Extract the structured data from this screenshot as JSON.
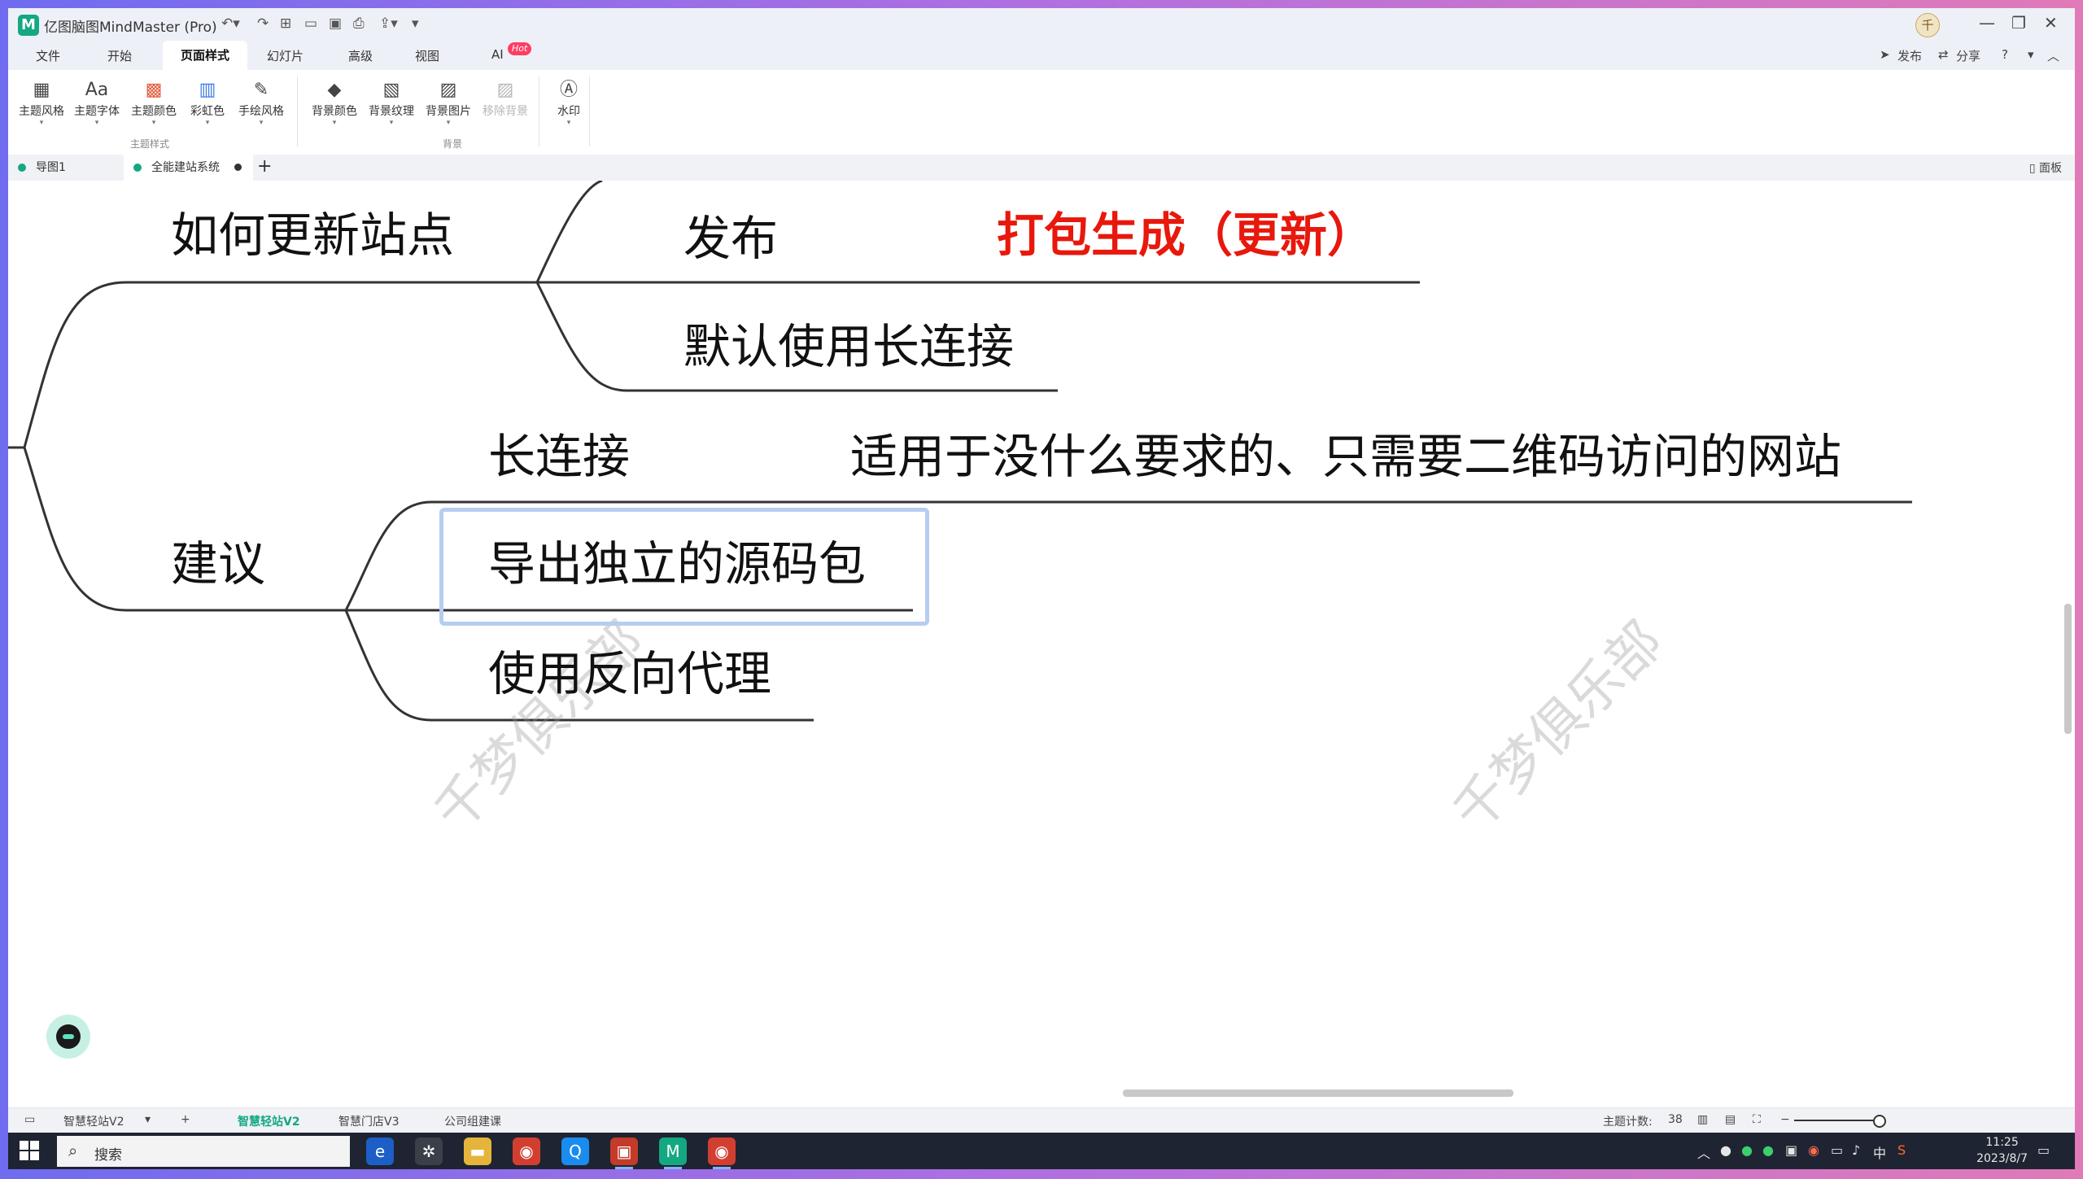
{
  "app": {
    "title": "亿图脑图MindMaster (Pro)",
    "user_initial": "千"
  },
  "menu": {
    "tabs": [
      "文件",
      "开始",
      "页面样式",
      "幻灯片",
      "高级",
      "视图",
      "AI"
    ],
    "active_tab": "页面样式",
    "ai_badge": "Hot",
    "publish": "发布",
    "share": "分享",
    "help": "?"
  },
  "ribbon": {
    "theme_style": "主题风格",
    "theme_font": "主题字体",
    "theme_color": "主题颜色",
    "rainbow": "彩虹色",
    "handdrawn": "手绘风格",
    "theme_group": "主题样式",
    "bg_color": "背景颜色",
    "bg_texture": "背景纹理",
    "bg_image": "背景图片",
    "remove_bg": "移除背景",
    "bg_group": "背景",
    "watermark": "水印"
  },
  "doc_tabs": {
    "tab1": "导图1",
    "tab2": "全能建站系统",
    "panel": "面板"
  },
  "mindmap": {
    "topics": {
      "update_site": "如何更新站点",
      "publish": "发布",
      "package_update": "打包生成（更新）",
      "default_long_conn": "默认使用长连接",
      "long_conn": "长连接",
      "long_conn_desc": "适用于没什么要求的、只需要二维码访问的网站",
      "suggestion": "建议",
      "export_source": "导出独立的源码包",
      "reverse_proxy": "使用反向代理"
    },
    "watermark_text": "千梦俱乐部"
  },
  "status": {
    "sheet_current": "智慧轻站V2",
    "sheets": [
      "智慧轻站V2",
      "智慧门店V3",
      "公司组建课"
    ],
    "topic_count_label": "主题计数:",
    "topic_count": "38"
  },
  "taskbar": {
    "search_placeholder": "搜索",
    "time": "11:25",
    "date": "2023/8/7",
    "ime": "中"
  }
}
